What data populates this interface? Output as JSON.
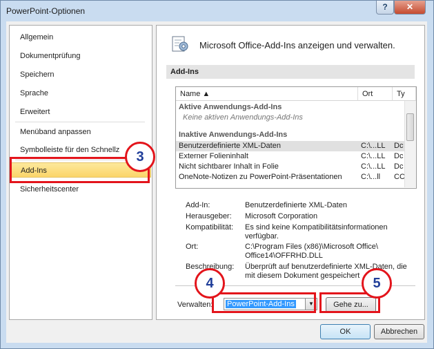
{
  "window": {
    "title": "PowerPoint-Optionen",
    "help_glyph": "?",
    "close_glyph": "✕"
  },
  "nav": {
    "items": [
      {
        "label": "Allgemein"
      },
      {
        "label": "Dokumentprüfung"
      },
      {
        "label": "Speichern"
      },
      {
        "label": "Sprache"
      },
      {
        "label": "Erweitert"
      },
      {
        "label": "Menüband anpassen"
      },
      {
        "label": "Symbolleiste für den Schnellz"
      },
      {
        "label": "Add-Ins",
        "selected": true
      },
      {
        "label": "Sicherheitscenter"
      }
    ]
  },
  "main": {
    "header": "Microsoft Office-Add-Ins anzeigen und verwalten.",
    "section_title": "Add-Ins",
    "columns": {
      "name": "Name ▲",
      "location": "Ort",
      "type": "Ty"
    },
    "groups": {
      "active": "Aktive Anwendungs-Add-Ins",
      "active_empty": "Keine aktiven Anwendungs-Add-Ins",
      "inactive": "Inaktive Anwendungs-Add-Ins"
    },
    "rows": [
      {
        "name": "Benutzerdefinierte XML-Daten",
        "location": "C:\\...LL",
        "type": "Dc"
      },
      {
        "name": "Externer Folieninhalt",
        "location": "C:\\...LL",
        "type": "Dc"
      },
      {
        "name": "Nicht sichtbarer Inhalt in Folie",
        "location": "C:\\...LL",
        "type": "Dc"
      },
      {
        "name": "OneNote-Notizen zu PowerPoint-Präsentationen",
        "location": "C:\\...ll",
        "type": "CC"
      }
    ],
    "details": {
      "addin_label": "Add-In:",
      "addin_value": "Benutzerdefinierte XML-Daten",
      "publisher_label": "Herausgeber:",
      "publisher_value": "Microsoft Corporation",
      "compat_label": "Kompatibilität:",
      "compat_value": "Es sind keine Kompatibilitätsinformationen verfügbar.",
      "location_label": "Ort:",
      "location_value": "C:\\Program Files (x86)\\Microsoft Office\\ Office14\\OFFRHD.DLL",
      "desc_label": "Beschreibung:",
      "desc_value": "Überprüft auf benutzerdefinierte XML-Daten, die mit diesem Dokument gespeichert"
    },
    "manage_label": "Verwalten:",
    "manage_value": "PowerPoint-Add-Ins",
    "goto_label": "Gehe zu..."
  },
  "buttons": {
    "ok": "OK",
    "cancel": "Abbrechen"
  },
  "callouts": {
    "c3": "3",
    "c4": "4",
    "c5": "5"
  },
  "colors": {
    "callout_border": "#e3141b",
    "callout_text": "#1f3d99",
    "selected_nav": "#fbd569"
  }
}
